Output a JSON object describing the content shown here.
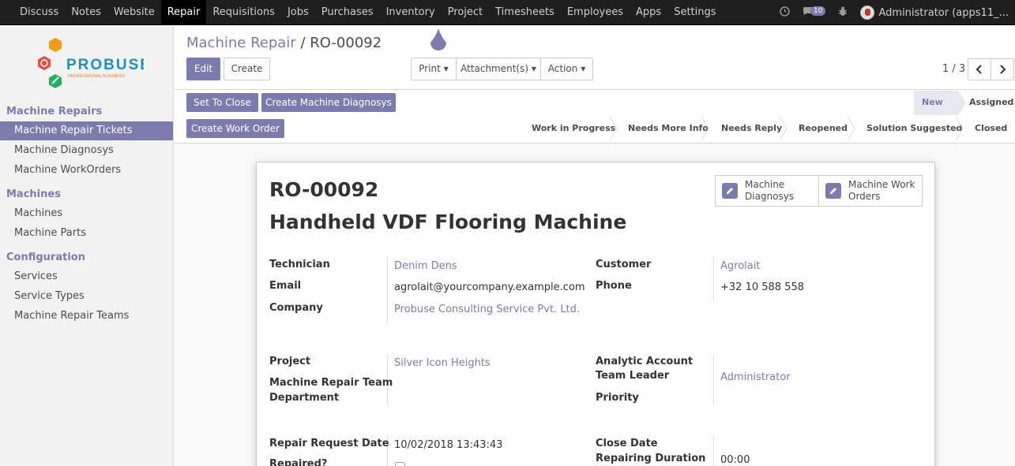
{
  "navbar": {
    "menu": [
      "Discuss",
      "Notes",
      "Website",
      "Repair",
      "Requisitions",
      "Jobs",
      "Purchases",
      "Inventory",
      "Project",
      "Timesheets",
      "Employees",
      "Apps",
      "Settings"
    ],
    "active": "Repair",
    "message_count": "10",
    "user": "Administrator (apps11_..."
  },
  "sidebar": {
    "logo": {
      "name": "PROBUSE",
      "tagline": "PROFESSIONAL BUSINESS"
    },
    "sections": [
      {
        "title": "Machine Repairs",
        "items": [
          "Machine Repair Tickets",
          "Machine Diagnosys",
          "Machine WorkOrders"
        ]
      },
      {
        "title": "Machines",
        "items": [
          "Machines",
          "Machine Parts"
        ]
      },
      {
        "title": "Configuration",
        "items": [
          "Services",
          "Service Types",
          "Machine Repair Teams"
        ]
      }
    ],
    "active_item": "Machine Repair Tickets"
  },
  "breadcrumb": {
    "parent": "Machine Repair",
    "separator": "/",
    "current": "RO-00092"
  },
  "buttons": {
    "edit": "Edit",
    "create": "Create",
    "print": "Print",
    "attachments": "Attachment(s)",
    "action": "Action"
  },
  "pager": {
    "value": "1 / 3"
  },
  "header_buttons": {
    "set_to_close": "Set To Close",
    "create_diagnosys": "Create Machine Diagnosys",
    "create_work_order": "Create Work Order"
  },
  "stages": {
    "row1": [
      "New",
      "Assigned"
    ],
    "row2": [
      "Work in Progress",
      "Needs More Info",
      "Needs Reply",
      "Reopened",
      "Solution Suggested",
      "Closed"
    ],
    "current": "New"
  },
  "smart_buttons": [
    {
      "line1": "Machine",
      "line2": "Diagnosys"
    },
    {
      "line1": "Machine Work",
      "line2": "Orders"
    }
  ],
  "record": {
    "reference": "RO-00092",
    "name": "Handheld VDF Flooring Machine"
  },
  "fields": {
    "technician": {
      "label": "Technician",
      "value": "Denim Dens"
    },
    "email": {
      "label": "Email",
      "value": "agrolait@yourcompany.example.com"
    },
    "company": {
      "label": "Company",
      "value": "Probuse Consulting Service Pvt. Ltd."
    },
    "customer": {
      "label": "Customer",
      "value": "Agrolait"
    },
    "phone": {
      "label": "Phone",
      "value": "+32 10 588 558"
    },
    "project": {
      "label": "Project",
      "value": "Silver Icon Heights"
    },
    "team": {
      "label": "Machine Repair Team"
    },
    "department": {
      "label": "Department"
    },
    "analytic": {
      "label": "Analytic Account"
    },
    "team_leader": {
      "label": "Team Leader",
      "value": "Administrator"
    },
    "priority": {
      "label": "Priority"
    },
    "request_date": {
      "label": "Repair Request Date",
      "value": "10/02/2018 13:43:43"
    },
    "repaired": {
      "label": "Repaired?"
    },
    "close_date": {
      "label": "Close Date"
    },
    "duration": {
      "label": "Repairing Duration",
      "value": "00:00"
    }
  }
}
